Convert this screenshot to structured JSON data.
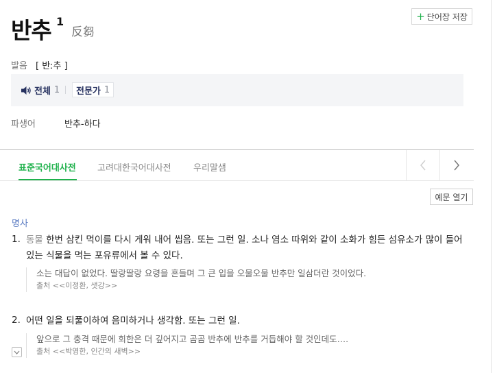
{
  "entry": {
    "headword": "반추",
    "superscript": "1",
    "hanja": "反芻"
  },
  "toolbar": {
    "wordbook_plus": "+",
    "wordbook_label": "단어장 저장"
  },
  "pronunciation": {
    "label": "발음",
    "value": "[ 반ː추 ]",
    "all_label": "전체",
    "all_count": "1",
    "expert_label": "전문가",
    "expert_count": "1"
  },
  "derivative": {
    "label": "파생어",
    "value": "반추-하다"
  },
  "tabs": [
    {
      "label": "표준국어대사전",
      "active": true
    },
    {
      "label": "고려대한국어대사전",
      "active": false
    },
    {
      "label": "우리말샘",
      "active": false
    }
  ],
  "open_examples_label": "예문 열기",
  "part_of_speech": "명사",
  "senses": [
    {
      "number": "1.",
      "field": "동물",
      "text": " 한번 삼킨 먹이를 다시 게워 내어 씹음. 또는 그런 일. 소나 염소 따위와 같이 소화가 힘든 섬유소가 많이 들어 있는 식물을 먹는 포유류에서 볼 수 있다.",
      "example": "소는 대답이 없었다. 딸랑딸랑 요령을 흔들며 그 큰 입을 오물오물 반추만 일삼더란 것이었다.",
      "source": "출처 <<이정환, 샛강>>"
    },
    {
      "number": "2.",
      "field": "",
      "text": "어떤 일을 되풀이하여 음미하거나 생각함. 또는 그런 일.",
      "example": "앞으로 그 충격 때문에 회한은 더 깊어지고 곰곰 반추에 반추를 거듭해야 할 것인데도….",
      "source": "출처 <<박영한, 인간의 새벽>>"
    }
  ],
  "colors": {
    "accent": "#1fb14c",
    "pos": "#5f7fc4",
    "pron_text": "#273260"
  }
}
